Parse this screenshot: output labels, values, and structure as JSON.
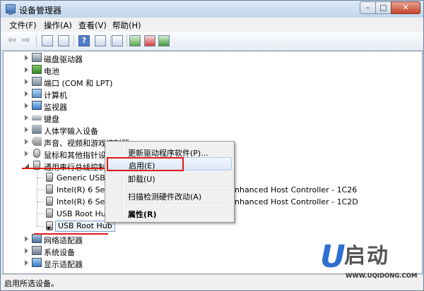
{
  "window": {
    "title": "设备管理器",
    "controls": {
      "minimize": "–",
      "maximize": "□",
      "close": "✕"
    }
  },
  "menu": [
    "文件(F)",
    "操作(A)",
    "查看(V)",
    "帮助(H)"
  ],
  "toolbar": [
    "back-arrow-icon",
    "forward-arrow-icon",
    "show-hide-console-tree-icon",
    "properties-icon",
    "help-icon",
    "scope-pane-icon",
    "update-driver-icon",
    "uninstall-icon",
    "scan-hardware-icon"
  ],
  "tree": {
    "categories_top": [
      {
        "label": "磁盘驱动器",
        "icon": "disk-drive-icon"
      },
      {
        "label": "电池",
        "icon": "battery-icon"
      },
      {
        "label": "端口 (COM 和 LPT)",
        "icon": "port-icon"
      },
      {
        "label": "计算机",
        "icon": "computer-icon"
      },
      {
        "label": "监视器",
        "icon": "monitor-icon"
      },
      {
        "label": "键盘",
        "icon": "keyboard-icon"
      },
      {
        "label": "人体学输入设备",
        "icon": "hid-icon"
      },
      {
        "label": "声音、视频和游戏控制器",
        "icon": "sound-icon"
      },
      {
        "label": "鼠标和其他指针设备",
        "icon": "mouse-icon"
      }
    ],
    "usb_category": {
      "label": "通用串行总线控制器",
      "icon": "usb-controller-icon"
    },
    "usb_children": [
      {
        "label": "Generic USB H"
      },
      {
        "label": "Intel(R) 6 Serie",
        "suffix": "nhanced Host Controller - 1C26"
      },
      {
        "label": "Intel(R) 6 Serie",
        "suffix": "nhanced Host Controller - 1C2D"
      },
      {
        "label": "USB Root Hub"
      },
      {
        "label": "USB Root Hub",
        "selected": true,
        "disabled": true
      }
    ],
    "categories_bottom": [
      {
        "label": "网络适配器",
        "icon": "network-adapter-icon"
      },
      {
        "label": "系统设备",
        "icon": "system-devices-icon"
      },
      {
        "label": "显示适配器",
        "icon": "display-adapter-icon"
      }
    ]
  },
  "context_menu": {
    "items": [
      {
        "label": "更新驱动程序软件(P)..."
      },
      {
        "label": "启用(E)",
        "highlighted": true
      },
      {
        "label": "卸载(U)"
      },
      {
        "label": "扫描检测硬件改动(A)"
      },
      {
        "label": "属性(R)",
        "bold": true
      }
    ]
  },
  "annotations": {
    "color": "#e01818"
  },
  "status": {
    "text": "启用所选设备。"
  },
  "watermark": {
    "logo_letter": "U",
    "brand": "启动",
    "url": "WWW.UQIDONG.COM"
  }
}
